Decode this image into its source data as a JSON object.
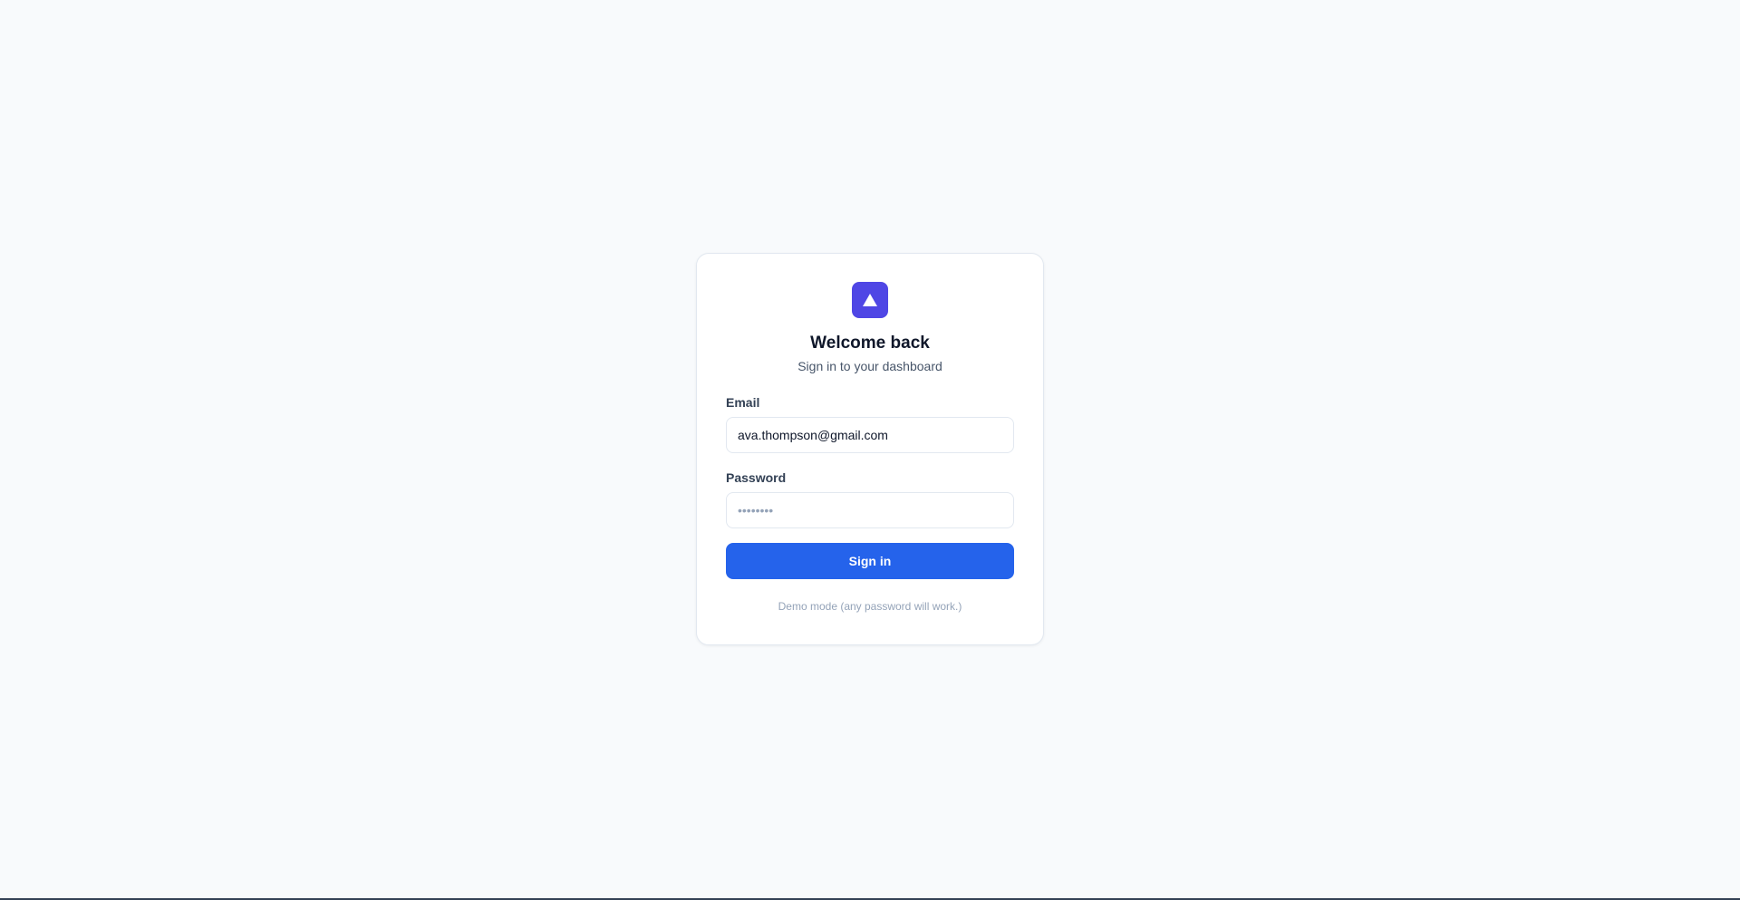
{
  "login": {
    "logo_icon": "triangle-icon",
    "accent_color": "#4f46e5",
    "title": "Welcome back",
    "subtitle": "Sign in to your dashboard",
    "email": {
      "label": "Email",
      "value": "ava.thompson@gmail.com"
    },
    "password": {
      "label": "Password",
      "placeholder": "••••••••"
    },
    "submit_label": "Sign in",
    "submit_color": "#2563eb",
    "hint": "Demo mode (any password will work.)"
  }
}
